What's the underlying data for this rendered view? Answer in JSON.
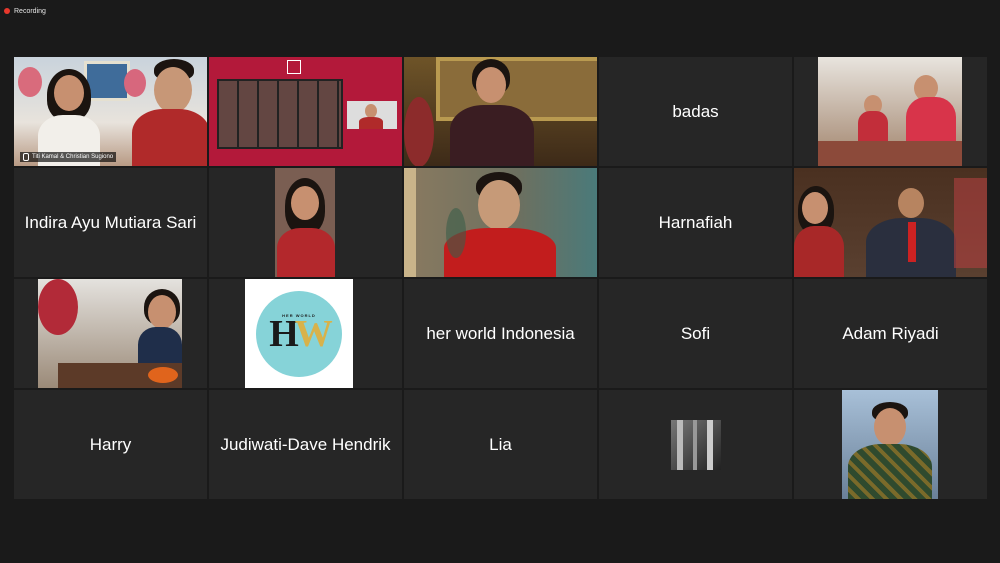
{
  "recording": {
    "label": "Recording"
  },
  "colors": {
    "active_border": "#c8d11c",
    "recording_dot": "#e8382c",
    "tile_bg": "#262626",
    "page_bg": "#1a1a1a"
  },
  "tiles": {
    "t1": {
      "label": "Titi Kamal & Christian Sugiono"
    },
    "t4": {
      "name": "badas"
    },
    "t6": {
      "name": "Indira Ayu Mutiara Sari"
    },
    "t9": {
      "name": "Harnafiah"
    },
    "t13": {
      "name": "her world Indonesia"
    },
    "t14": {
      "name": "Sofi"
    },
    "t15": {
      "name": "Adam Riyadi"
    },
    "t16": {
      "name": "Harry"
    },
    "t17": {
      "name": "Judiwati-Dave Hendrik"
    },
    "t18": {
      "name": "Lia"
    }
  },
  "hw_logo": {
    "small": "HER WORLD",
    "h": "H",
    "w": "W"
  }
}
